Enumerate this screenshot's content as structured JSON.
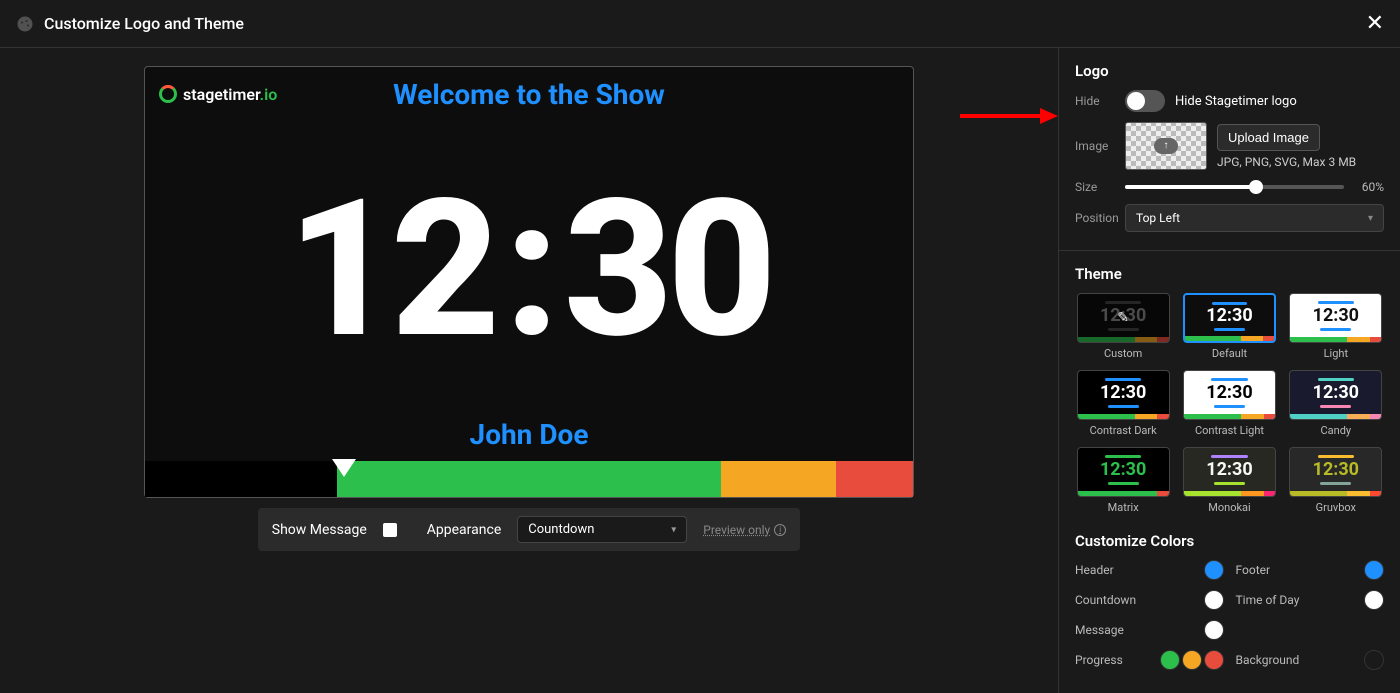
{
  "header": {
    "title": "Customize Logo and Theme"
  },
  "preview": {
    "logo_text": "stagetimer",
    "logo_suffix": ".io",
    "welcome": "Welcome to the Show",
    "time_left": "12",
    "time_right": "30",
    "speaker": "John Doe"
  },
  "controls": {
    "show_message_label": "Show Message",
    "appearance_label": "Appearance",
    "appearance_value": "Countdown",
    "preview_only_label": "Preview only"
  },
  "panel": {
    "logo_section": {
      "title": "Logo",
      "hide_label": "Hide",
      "hide_toggle_label": "Hide Stagetimer logo",
      "image_label": "Image",
      "upload_button": "Upload Image",
      "upload_hint": "JPG, PNG, SVG, Max 3 MB",
      "size_label": "Size",
      "size_value": "60%",
      "position_label": "Position",
      "position_value": "Top Left"
    },
    "theme_section": {
      "title": "Theme",
      "themes": [
        {
          "name": "Custom",
          "bg": "#0d0d0d",
          "fg": "#888",
          "header": "#444",
          "sub": "#444",
          "bar": [
            "#2dbf4b",
            "#f5a623",
            "#e74c3c"
          ],
          "dim": true
        },
        {
          "name": "Default",
          "bg": "#0d0d0d",
          "fg": "#fff",
          "header": "#1e90ff",
          "sub": "#1e90ff",
          "bar": [
            "#2dbf4b",
            "#f5a623",
            "#e74c3c"
          ],
          "selected": true
        },
        {
          "name": "Light",
          "bg": "#fff",
          "fg": "#111",
          "header": "#1e90ff",
          "sub": "#1e90ff",
          "bar": [
            "#2dbf4b",
            "#f5a623",
            "#e74c3c"
          ]
        },
        {
          "name": "Contrast Dark",
          "bg": "#000",
          "fg": "#fff",
          "header": "#1e90ff",
          "sub": "#1e90ff",
          "bar": [
            "#2dbf4b",
            "#f5a623",
            "#e74c3c"
          ]
        },
        {
          "name": "Contrast Light",
          "bg": "#fff",
          "fg": "#000",
          "header": "#1e90ff",
          "sub": "#1e90ff",
          "bar": [
            "#2dbf4b",
            "#f5a623",
            "#e74c3c"
          ]
        },
        {
          "name": "Candy",
          "bg": "#1a1a2e",
          "fg": "#fff",
          "header": "#4fd1c5",
          "sub": "#f687b3",
          "bar": [
            "#4fd1c5",
            "#f6ad55",
            "#f687b3"
          ]
        },
        {
          "name": "Matrix",
          "bg": "#000",
          "fg": "#2dbf4b",
          "header": "#2dbf4b",
          "sub": "#2dbf4b",
          "bar": [
            "#2dbf4b",
            "#2dbf4b",
            "#e74c3c"
          ]
        },
        {
          "name": "Monokai",
          "bg": "#272822",
          "fg": "#f8f8f2",
          "header": "#ae81ff",
          "sub": "#a6e22e",
          "bar": [
            "#a6e22e",
            "#fd971f",
            "#f92672"
          ]
        },
        {
          "name": "Gruvbox",
          "bg": "#282828",
          "fg": "#b8bb26",
          "header": "#fabd2f",
          "sub": "#83a598",
          "bar": [
            "#b8bb26",
            "#fabd2f",
            "#fb4934"
          ]
        }
      ],
      "theme_time": "12:30"
    },
    "colors_section": {
      "title": "Customize Colors",
      "items": [
        {
          "label": "Header",
          "colors": [
            "#1e90ff"
          ]
        },
        {
          "label": "Footer",
          "colors": [
            "#1e90ff"
          ]
        },
        {
          "label": "Countdown",
          "colors": [
            "#ffffff"
          ]
        },
        {
          "label": "Time of Day",
          "colors": [
            "#ffffff"
          ]
        },
        {
          "label": "Message",
          "colors": [
            "#ffffff"
          ]
        },
        {
          "label": "",
          "colors": []
        },
        {
          "label": "Progress",
          "colors": [
            "#2dbf4b",
            "#f5a623",
            "#e74c3c"
          ]
        },
        {
          "label": "Background",
          "colors": [
            "#1a1a1a"
          ]
        }
      ]
    }
  }
}
